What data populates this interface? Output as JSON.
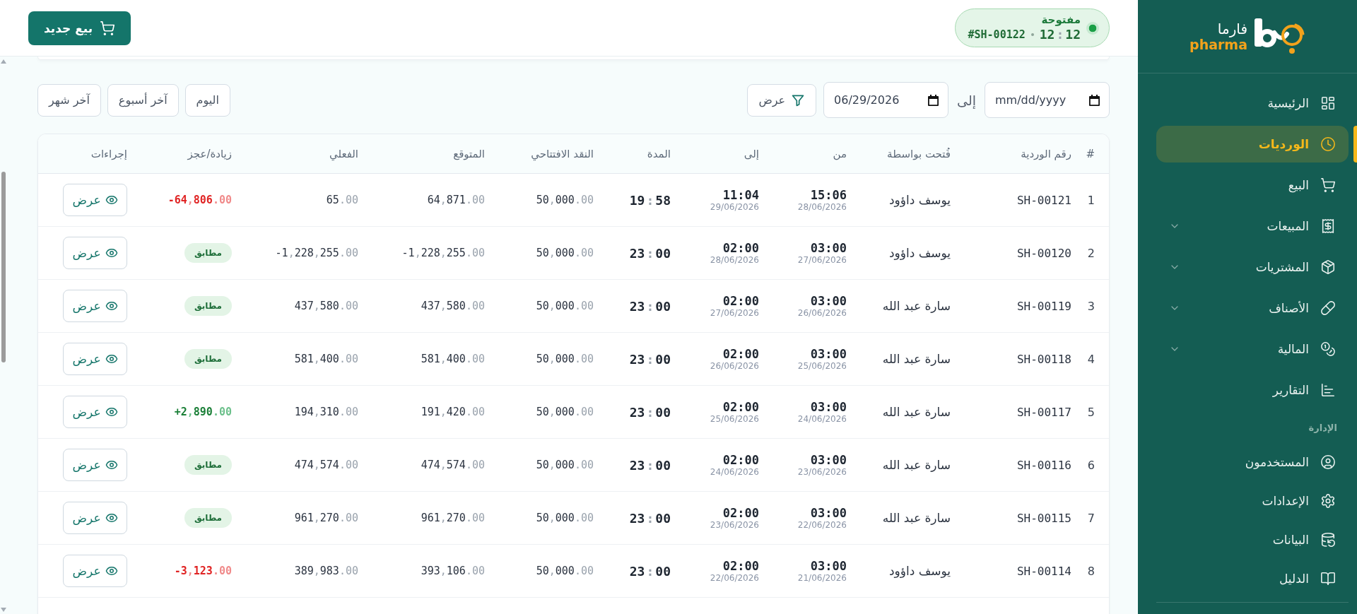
{
  "sidebar": {
    "logo": {
      "arabic": "فارما",
      "latin": "pharma"
    },
    "items": [
      {
        "label": "الرئيسية",
        "kind": "link",
        "selected": false
      },
      {
        "label": "الورديات",
        "kind": "link",
        "selected": true
      },
      {
        "label": "البيع",
        "kind": "link",
        "selected": false
      },
      {
        "label": "المبيعات",
        "kind": "group",
        "expanded": false,
        "selected": false
      },
      {
        "label": "المشتريات",
        "kind": "group",
        "expanded": false,
        "selected": false
      },
      {
        "label": "الأصناف",
        "kind": "group",
        "expanded": false,
        "selected": false
      },
      {
        "label": "المالية",
        "kind": "group",
        "expanded": false,
        "selected": false
      },
      {
        "label": "التقارير",
        "kind": "link",
        "selected": false
      }
    ],
    "section_title": "الإدارة",
    "admin_items": [
      {
        "label": "المستخدمون",
        "kind": "link",
        "selected": false
      },
      {
        "label": "الإعدادات",
        "kind": "link",
        "selected": false
      },
      {
        "label": "البيانات",
        "kind": "link",
        "selected": false
      },
      {
        "label": "الدليل",
        "kind": "link",
        "selected": false
      }
    ]
  },
  "header": {
    "shift_status": {
      "kind": "open",
      "label": "مفتوحة",
      "time": "12:12",
      "shift_number": "#SH-00122"
    },
    "new_sale_button": "بيع جديد"
  },
  "filters": {
    "from": {
      "placeholder": "mm/dd/yyyy"
    },
    "to_label": "إلى",
    "to": {
      "value": "06/29/2026"
    },
    "apply_button": "عرض",
    "quick_ranges": [
      "اليوم",
      "آخر أسبوع",
      "آخر شهر"
    ]
  },
  "table": {
    "columns": [
      "#",
      "رقم الوردية",
      "فُتحت بواسطة",
      "من",
      "إلى",
      "المدة",
      "النقد الافتتاحي",
      "المتوقع",
      "الفعلي",
      "زيادة/عجز",
      "إجراءات"
    ],
    "rows": [
      {
        "index": "1",
        "shift_number": "SH-00121",
        "opened_by": "يوسف داؤود",
        "from": {
          "time": "15:06",
          "date": "28/06/2026"
        },
        "to": {
          "time": "11:04",
          "date": "29/06/2026"
        },
        "duration": "19:58",
        "opening_cash": "50,000.00",
        "expected": "64,871.00",
        "actual": "65.00",
        "difference": {
          "kind": "shortage",
          "text": "-64,806.00"
        },
        "action": "عرض"
      },
      {
        "index": "2",
        "shift_number": "SH-00120",
        "opened_by": "يوسف داؤود",
        "from": {
          "time": "03:00",
          "date": "27/06/2026"
        },
        "to": {
          "time": "02:00",
          "date": "28/06/2026"
        },
        "duration": "23:00",
        "opening_cash": "50,000.00",
        "expected": "-1,228,255.00",
        "actual": "-1,228,255.00",
        "difference": {
          "kind": "match",
          "text": "مطابق"
        },
        "action": "عرض"
      },
      {
        "index": "3",
        "shift_number": "SH-00119",
        "opened_by": "سارة عبد الله",
        "from": {
          "time": "03:00",
          "date": "26/06/2026"
        },
        "to": {
          "time": "02:00",
          "date": "27/06/2026"
        },
        "duration": "23:00",
        "opening_cash": "50,000.00",
        "expected": "437,580.00",
        "actual": "437,580.00",
        "difference": {
          "kind": "match",
          "text": "مطابق"
        },
        "action": "عرض"
      },
      {
        "index": "4",
        "shift_number": "SH-00118",
        "opened_by": "سارة عبد الله",
        "from": {
          "time": "03:00",
          "date": "25/06/2026"
        },
        "to": {
          "time": "02:00",
          "date": "26/06/2026"
        },
        "duration": "23:00",
        "opening_cash": "50,000.00",
        "expected": "581,400.00",
        "actual": "581,400.00",
        "difference": {
          "kind": "match",
          "text": "مطابق"
        },
        "action": "عرض"
      },
      {
        "index": "5",
        "shift_number": "SH-00117",
        "opened_by": "سارة عبد الله",
        "from": {
          "time": "03:00",
          "date": "24/06/2026"
        },
        "to": {
          "time": "02:00",
          "date": "25/06/2026"
        },
        "duration": "23:00",
        "opening_cash": "50,000.00",
        "expected": "191,420.00",
        "actual": "194,310.00",
        "difference": {
          "kind": "surplus",
          "text": "+2,890.00"
        },
        "action": "عرض"
      },
      {
        "index": "6",
        "shift_number": "SH-00116",
        "opened_by": "سارة عبد الله",
        "from": {
          "time": "03:00",
          "date": "23/06/2026"
        },
        "to": {
          "time": "02:00",
          "date": "24/06/2026"
        },
        "duration": "23:00",
        "opening_cash": "50,000.00",
        "expected": "474,574.00",
        "actual": "474,574.00",
        "difference": {
          "kind": "match",
          "text": "مطابق"
        },
        "action": "عرض"
      },
      {
        "index": "7",
        "shift_number": "SH-00115",
        "opened_by": "سارة عبد الله",
        "from": {
          "time": "03:00",
          "date": "22/06/2026"
        },
        "to": {
          "time": "02:00",
          "date": "23/06/2026"
        },
        "duration": "23:00",
        "opening_cash": "50,000.00",
        "expected": "961,270.00",
        "actual": "961,270.00",
        "difference": {
          "kind": "match",
          "text": "مطابق"
        },
        "action": "عرض"
      },
      {
        "index": "8",
        "shift_number": "SH-00114",
        "opened_by": "يوسف داؤود",
        "from": {
          "time": "03:00",
          "date": "21/06/2026"
        },
        "to": {
          "time": "02:00",
          "date": "22/06/2026"
        },
        "duration": "23:00",
        "opening_cash": "50,000.00",
        "expected": "393,106.00",
        "actual": "389,983.00",
        "difference": {
          "kind": "shortage",
          "text": "-3,123.00"
        },
        "action": "عرض"
      }
    ]
  }
}
